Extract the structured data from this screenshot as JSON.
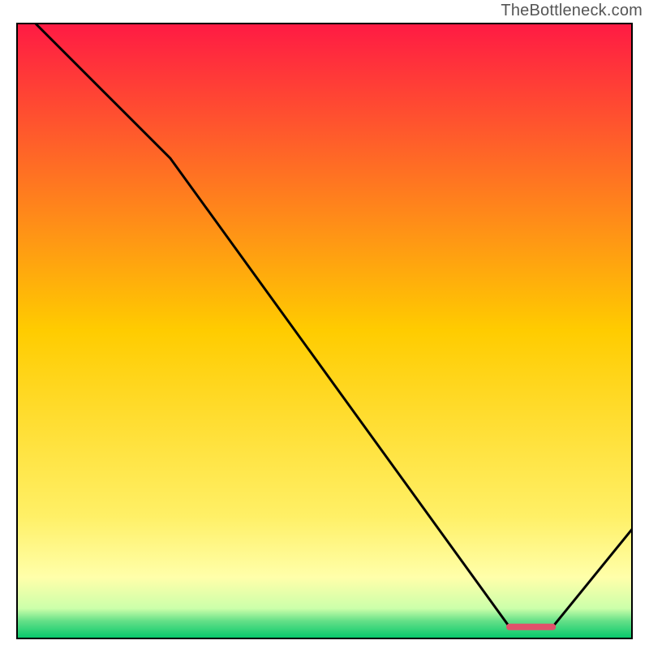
{
  "attribution": "TheBottleneck.com",
  "chart_data": {
    "type": "line",
    "xlim": [
      0,
      100
    ],
    "ylim": [
      0,
      100
    ],
    "line": {
      "x": [
        3,
        25,
        80,
        87,
        100
      ],
      "y": [
        100,
        78,
        2,
        2,
        18
      ]
    },
    "highlight_segment": {
      "x_start": 80,
      "x_end": 87,
      "y": 2
    },
    "gradient_stops": [
      {
        "offset": 0.0,
        "color": "#ff1a44"
      },
      {
        "offset": 0.5,
        "color": "#ffcc00"
      },
      {
        "offset": 0.8,
        "color": "#fff066"
      },
      {
        "offset": 0.9,
        "color": "#ffffaa"
      },
      {
        "offset": 0.95,
        "color": "#ccffaa"
      },
      {
        "offset": 0.97,
        "color": "#66e088"
      },
      {
        "offset": 1.0,
        "color": "#00c76a"
      }
    ],
    "title": "",
    "xlabel": "",
    "ylabel": ""
  }
}
